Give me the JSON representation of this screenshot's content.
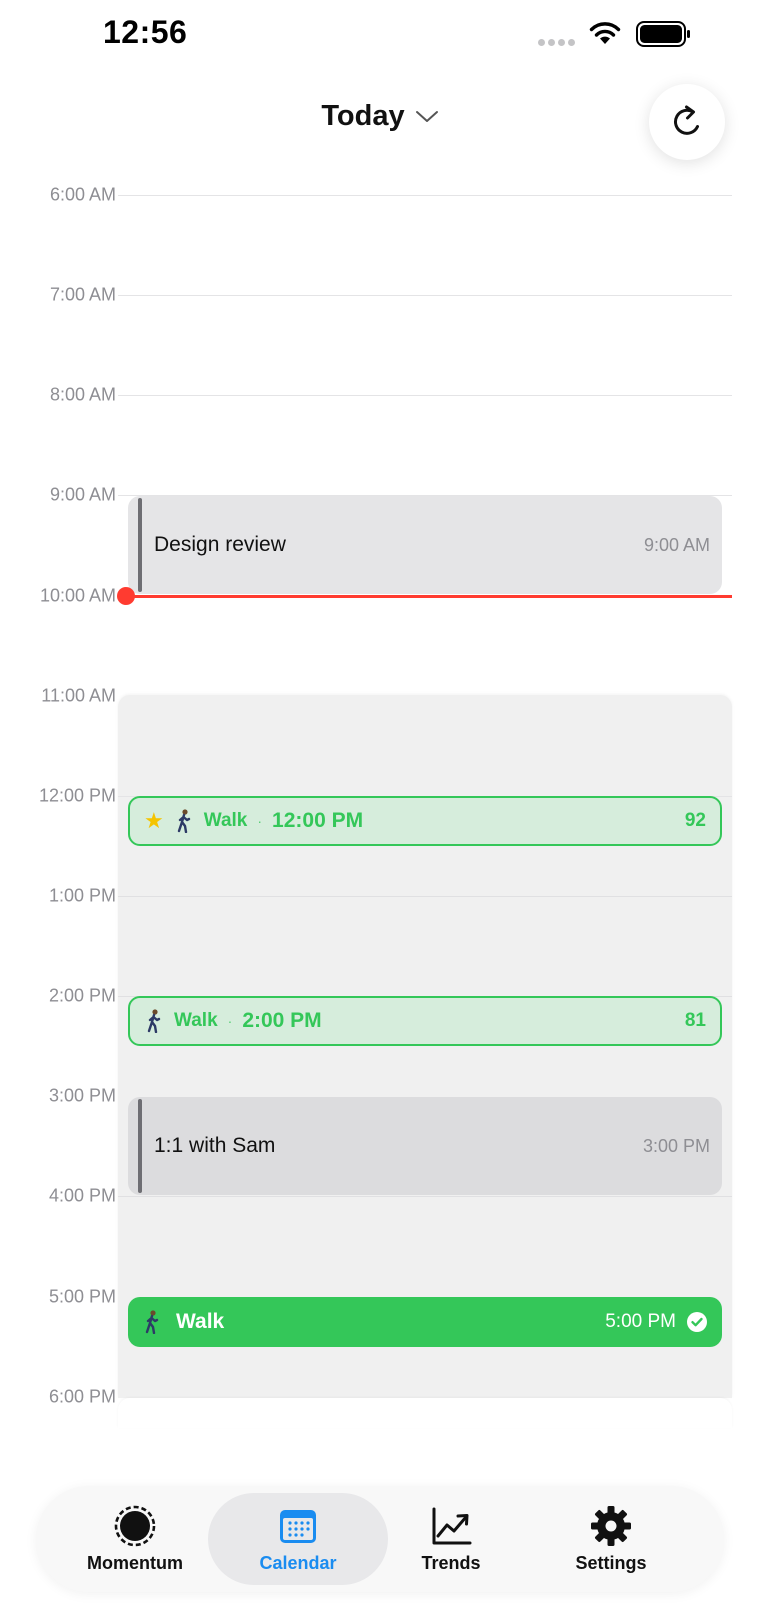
{
  "status_bar": {
    "time": "12:56"
  },
  "header": {
    "title": "Today"
  },
  "timeline": {
    "hours": [
      "6:00 AM",
      "7:00 AM",
      "8:00 AM",
      "9:00 AM",
      "10:00 AM",
      "11:00 AM",
      "12:00 PM",
      "1:00 PM",
      "2:00 PM",
      "3:00 PM",
      "4:00 PM",
      "5:00 PM",
      "6:00 PM"
    ]
  },
  "events": {
    "design_review": {
      "title": "Design review",
      "time": "9:00 AM"
    },
    "one_on_one": {
      "title": "1:1 with Sam",
      "time": "3:00 PM"
    }
  },
  "walks": {
    "noon": {
      "label": "Walk",
      "separator": "·",
      "time": "12:00 PM",
      "score": "92",
      "starred": true
    },
    "afternoon": {
      "label": "Walk",
      "separator": "·",
      "time": "2:00 PM",
      "score": "81",
      "starred": false
    },
    "evening": {
      "label": "Walk",
      "time": "5:00 PM",
      "completed": true
    }
  },
  "tabs": [
    {
      "label": "Momentum",
      "icon": "momentum-icon",
      "active": false
    },
    {
      "label": "Calendar",
      "icon": "calendar-icon",
      "active": true
    },
    {
      "label": "Trends",
      "icon": "trends-icon",
      "active": false
    },
    {
      "label": "Settings",
      "icon": "gear-icon",
      "active": false
    }
  ],
  "colors": {
    "accent_green": "#34c759",
    "now_indicator": "#ff3b30",
    "active_tab": "#1a8cf0"
  }
}
